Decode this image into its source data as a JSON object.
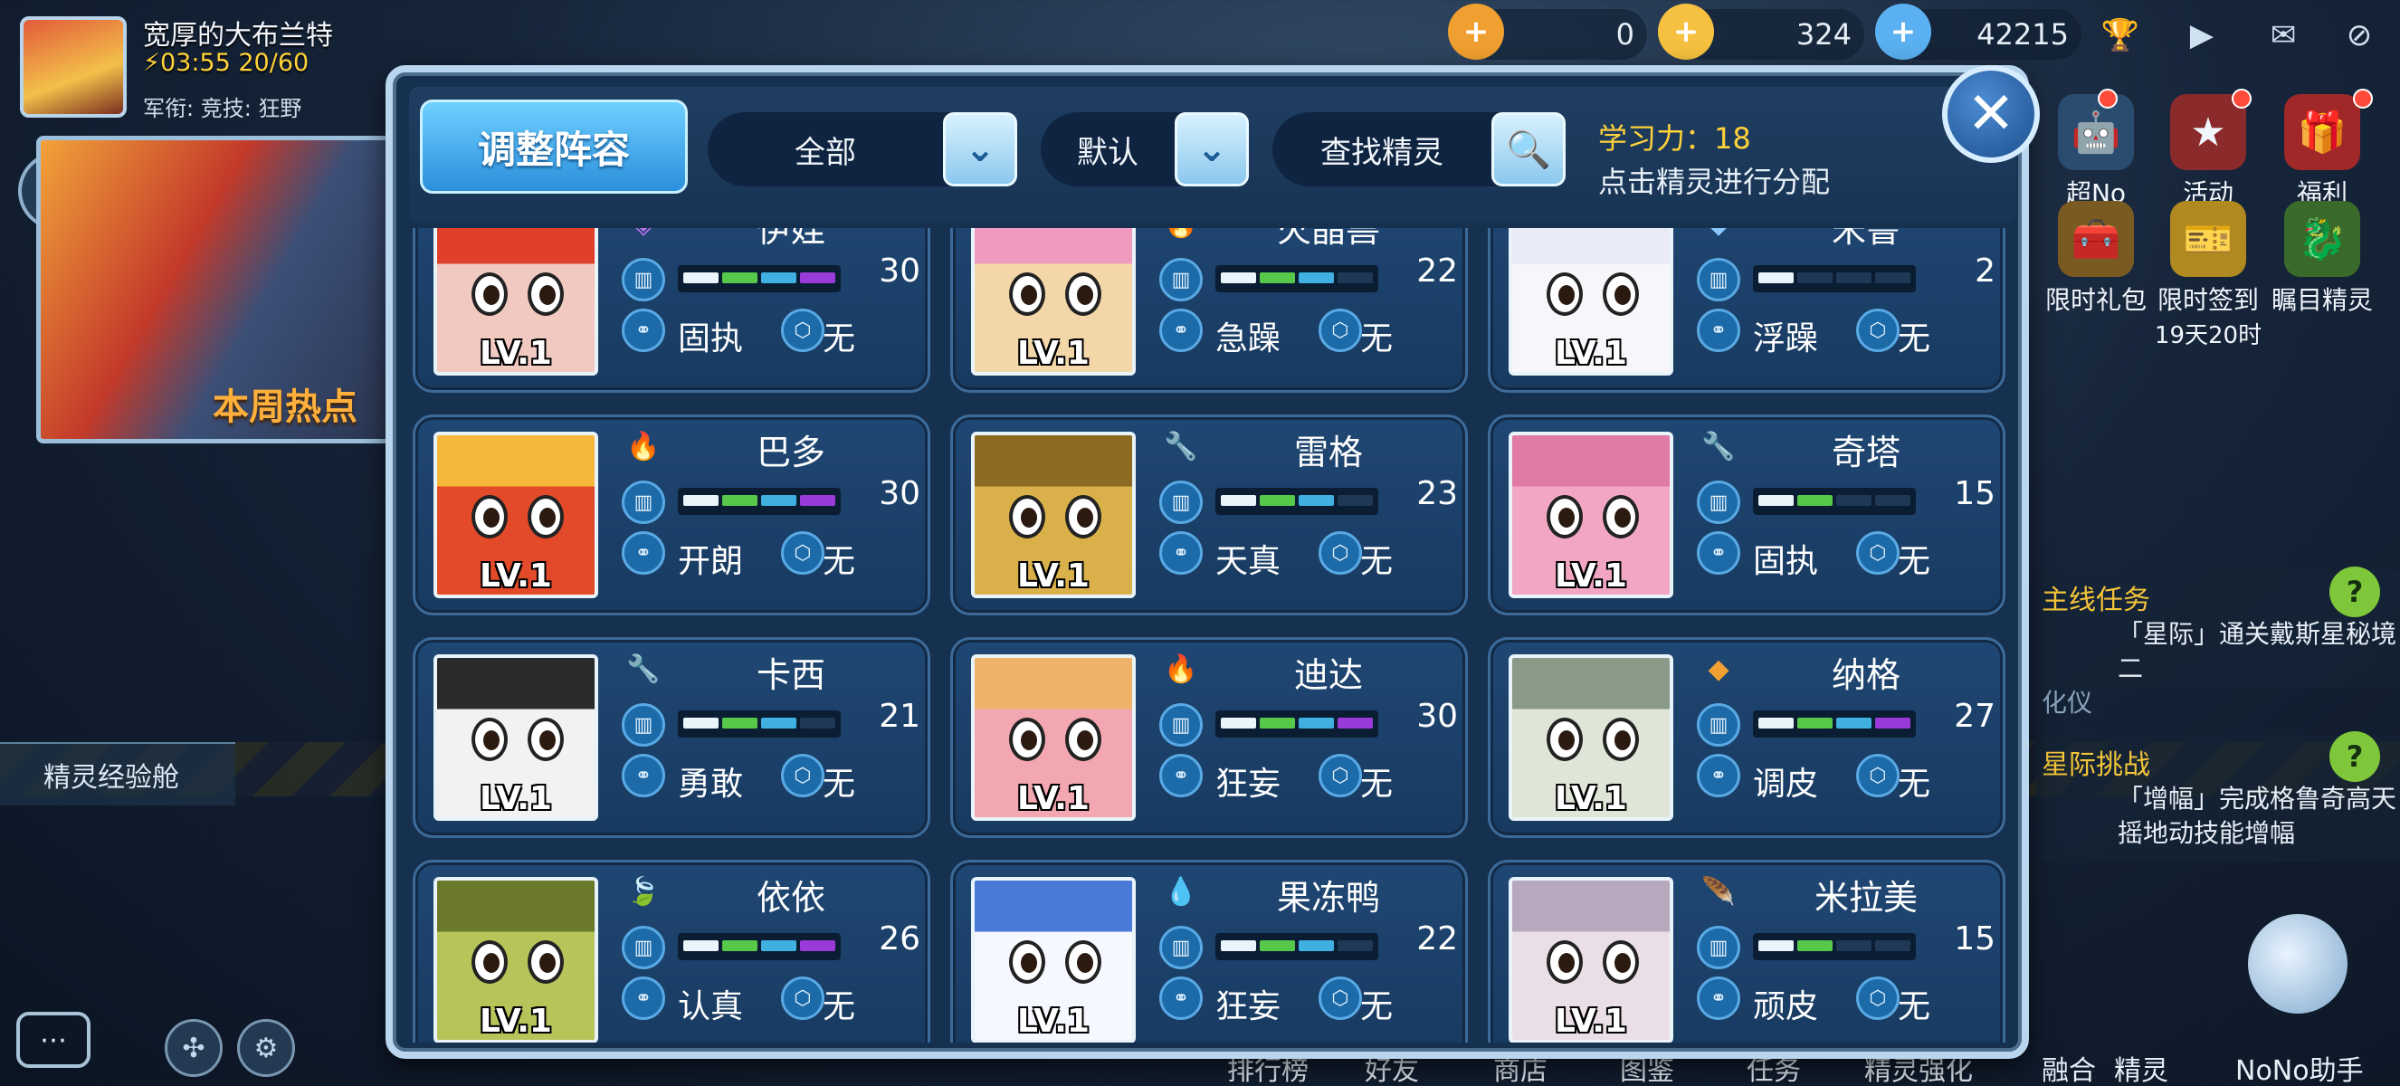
{
  "player": {
    "name": "宽厚的大布兰特",
    "energy": "03:55",
    "stamina": "20/60",
    "rank_labels": "军衔:  竞技:  狂野"
  },
  "left": {
    "banner_text": "本周热点",
    "exp_cabin": "精灵经验舱",
    "chat_icon": "chat-icon"
  },
  "resources": [
    {
      "icon": "coin-plus",
      "value": "0",
      "color": "#f0a030"
    },
    {
      "icon": "gold-plus",
      "value": "324",
      "color": "#f6c040"
    },
    {
      "icon": "diamond-plus",
      "value": "42215",
      "color": "#5ab0f0"
    }
  ],
  "top_icons": [
    "trophy-icon",
    "play-icon",
    "mail-icon",
    "eye-off-icon"
  ],
  "right_buttons": {
    "row1": [
      "超No",
      "活动",
      "福利"
    ],
    "row2": [
      "限时礼包",
      "限时签到",
      "瞩目精灵"
    ],
    "countdown": "19天20时"
  },
  "quests": {
    "main_title": "主线任务",
    "main_text": "「星际」通关戴斯星秘境二",
    "main_extra": "化仪",
    "star_title": "星际挑战",
    "star_text": "「增幅」完成格鲁奇高天摇地动技能增幅"
  },
  "bottom_nav": [
    "排行榜",
    "好友",
    "商店",
    "图鉴",
    "任务",
    "精灵强化",
    "融合",
    "精灵",
    "NoNo助手"
  ],
  "panel": {
    "title_tab": "调整阵容",
    "filter_all": "全部",
    "filter_sort": "默认",
    "search_label": "查找精灵",
    "learn_power": "学习力：18",
    "learn_hint": "点击精灵进行分配",
    "close_label": "✕"
  },
  "spirits": [
    {
      "name": "伊娃",
      "element": "◈",
      "elem_color": "#c070f0",
      "value": "30",
      "level": 4,
      "trait": "固执",
      "fruit": "无",
      "lv": "LV.1",
      "skin": "#f2c9c0",
      "hair": "#e0402a"
    },
    {
      "name": "火晶兽",
      "element": "🔥",
      "elem_color": "#ff6a2a",
      "value": "22",
      "level": 3,
      "trait": "急躁",
      "fruit": "无",
      "lv": "LV.1",
      "skin": "#f4d7a8",
      "hair": "#f09ac0"
    },
    {
      "name": "米鲁",
      "element": "◆",
      "elem_color": "#8cc8ff",
      "value": "2",
      "level": 1,
      "trait": "浮躁",
      "fruit": "无",
      "lv": "LV.1",
      "skin": "#f7f7fb",
      "hair": "#e9ecf6"
    },
    {
      "name": "巴多",
      "element": "🔥",
      "elem_color": "#ff6a2a",
      "value": "30",
      "level": 4,
      "trait": "开朗",
      "fruit": "无",
      "lv": "LV.1",
      "skin": "#e24a2a",
      "hair": "#f6b83a"
    },
    {
      "name": "雷格",
      "element": "🔧",
      "elem_color": "#c9c9c9",
      "value": "23",
      "level": 3,
      "trait": "天真",
      "fruit": "无",
      "lv": "LV.1",
      "skin": "#d9b04a",
      "hair": "#8c6a22"
    },
    {
      "name": "奇塔",
      "element": "🔧",
      "elem_color": "#c9c9c9",
      "value": "15",
      "level": 2,
      "trait": "固执",
      "fruit": "无",
      "lv": "LV.1",
      "skin": "#f2a6c4",
      "hair": "#e07aa6"
    },
    {
      "name": "卡西",
      "element": "🔧",
      "elem_color": "#c9c9c9",
      "value": "21",
      "level": 3,
      "trait": "勇敢",
      "fruit": "无",
      "lv": "LV.1",
      "skin": "#f2f2f2",
      "hair": "#2a2a2a"
    },
    {
      "name": "迪达",
      "element": "🔥",
      "elem_color": "#ff6a2a",
      "value": "30",
      "level": 4,
      "trait": "狂妄",
      "fruit": "无",
      "lv": "LV.1",
      "skin": "#f3a7b0",
      "hair": "#f0b26a"
    },
    {
      "name": "纳格",
      "element": "◆",
      "elem_color": "#f0a030",
      "value": "27",
      "level": 4,
      "trait": "调皮",
      "fruit": "无",
      "lv": "LV.1",
      "skin": "#dfe6d8",
      "hair": "#8a9a88"
    },
    {
      "name": "依依",
      "element": "🍃",
      "elem_color": "#6ad04a",
      "value": "26",
      "level": 4,
      "trait": "认真",
      "fruit": "无",
      "lv": "LV.1",
      "skin": "#b6c45a",
      "hair": "#6a7a2a"
    },
    {
      "name": "果冻鸭",
      "element": "💧",
      "elem_color": "#4ab0ff",
      "value": "22",
      "level": 3,
      "trait": "狂妄",
      "fruit": "无",
      "lv": "LV.1",
      "skin": "#f6f8ff",
      "hair": "#4a7ad8"
    },
    {
      "name": "米拉美",
      "element": "🪶",
      "elem_color": "#e0b090",
      "value": "15",
      "level": 2,
      "trait": "顽皮",
      "fruit": "无",
      "lv": "LV.1",
      "skin": "#eadfe6",
      "hair": "#b7a8bd"
    }
  ],
  "colors": {
    "accent": "#4ec0ff",
    "gold": "#ffd23a",
    "panel": "#16304f"
  }
}
